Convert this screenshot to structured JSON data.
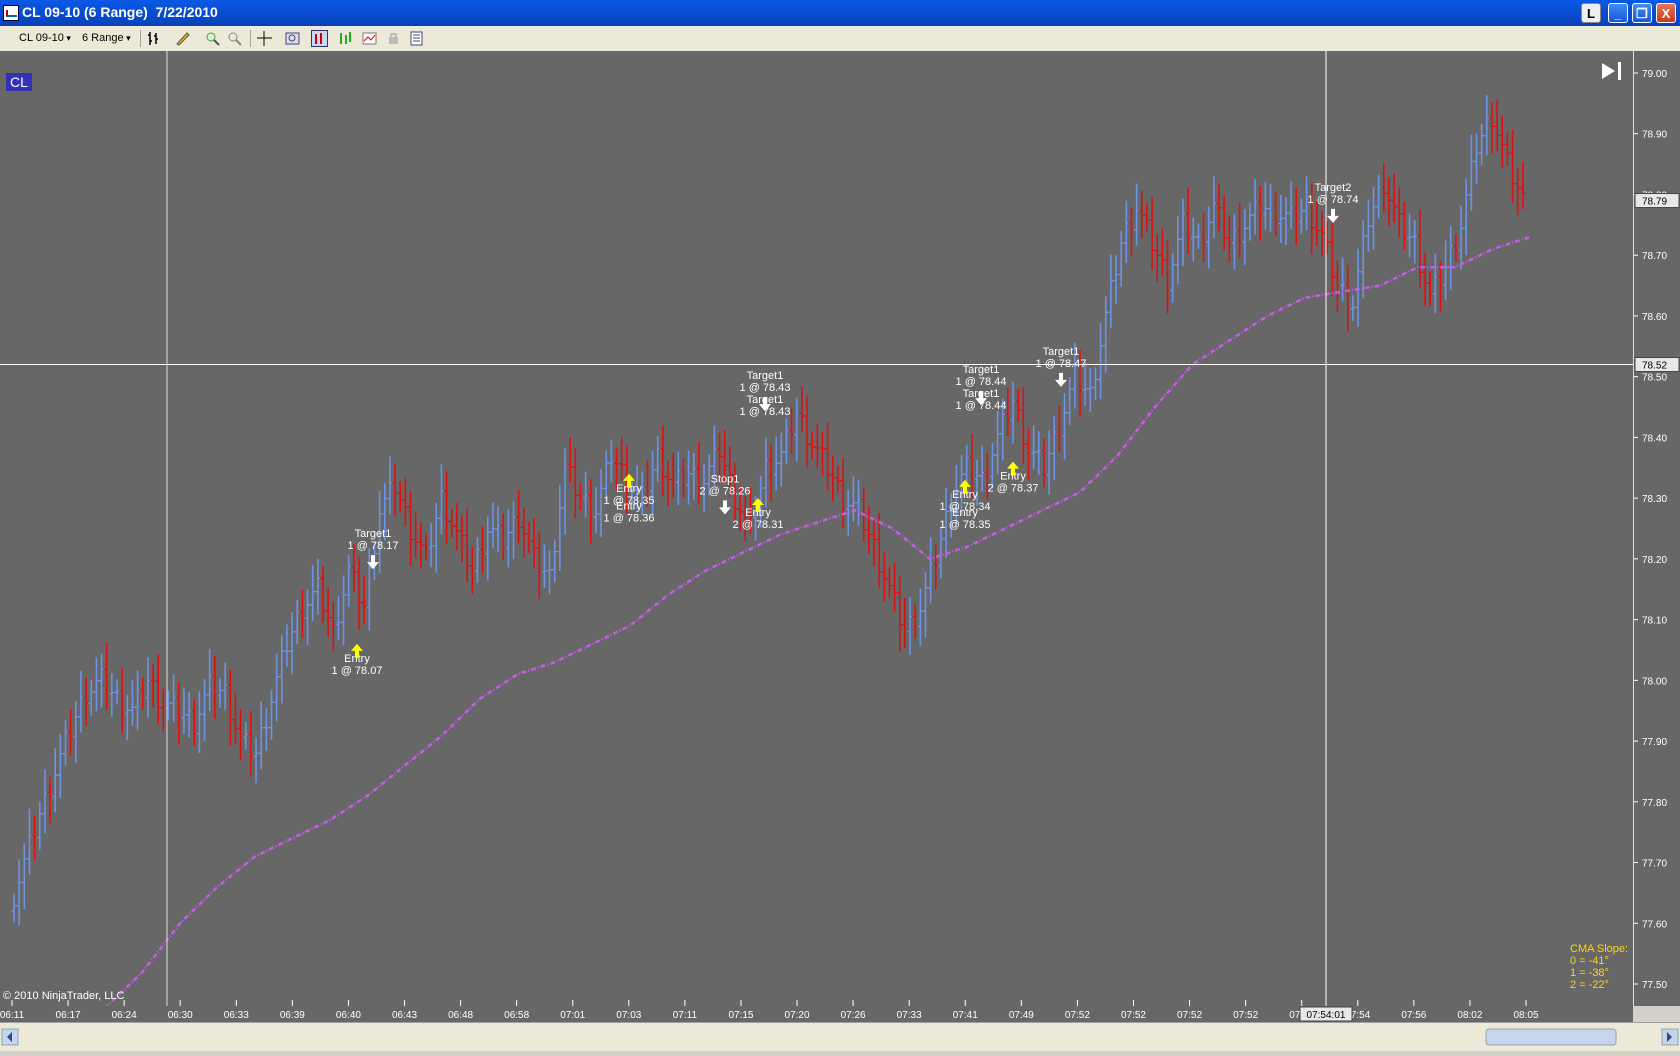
{
  "window": {
    "title": "CL 09-10 (6 Range)  7/22/2010",
    "buttons": [
      "L",
      "_",
      "❐",
      "X"
    ]
  },
  "toolbar": {
    "instrument": "CL 09-10",
    "period": "6 Range"
  },
  "chart": {
    "instrument_badge": "CL",
    "copyright": "© 2010 NinjaTrader, LLC",
    "crosshair_price": "78.52",
    "crosshair_time": "07:54:01",
    "last_price": "78.79",
    "indicator": {
      "title": "CMA Slope:",
      "lines": [
        "0 = -41°",
        "1 = -38°",
        "2 = -22°"
      ]
    },
    "colors": {
      "background": "#676767",
      "up_bar": "#6b93e6",
      "down_bar": "#e01010",
      "cma": "#c45ce6",
      "entry_arrow": "#ffff00",
      "exit_arrow": "#ffffff"
    }
  },
  "chart_data": {
    "type": "bar",
    "subtype": "ohlc-range-bars",
    "ylim": [
      77.5,
      79.0
    ],
    "y_ticks": [
      "79.00",
      "78.90",
      "78.80",
      "78.70",
      "78.60",
      "78.50",
      "78.40",
      "78.30",
      "78.20",
      "78.10",
      "78.00",
      "77.90",
      "77.80",
      "77.70",
      "77.60",
      "77.50"
    ],
    "x_ticks": [
      "06:11",
      "06:17",
      "06:24",
      "06:30",
      "06:33",
      "06:39",
      "06:40",
      "06:43",
      "06:48",
      "06:58",
      "07:01",
      "07:03",
      "07:11",
      "07:15",
      "07:20",
      "07:26",
      "07:33",
      "07:41",
      "07:49",
      "07:52",
      "07:52",
      "07:52",
      "07:52",
      "07:52",
      "07:54",
      "07:56",
      "08:02",
      "08:05"
    ],
    "price_path": [
      77.62,
      77.7,
      77.78,
      77.85,
      77.92,
      77.98,
      78.0,
      77.97,
      77.95,
      78.0,
      77.96,
      77.95,
      77.93,
      77.99,
      77.98,
      77.9,
      77.88,
      77.97,
      78.06,
      78.12,
      78.15,
      78.08,
      78.18,
      78.12,
      78.28,
      78.32,
      78.25,
      78.2,
      78.3,
      78.24,
      78.18,
      78.25,
      78.23,
      78.27,
      78.2,
      78.17,
      78.35,
      78.3,
      78.28,
      78.37,
      78.33,
      78.3,
      78.37,
      78.32,
      78.34,
      78.33,
      78.38,
      78.3,
      78.25,
      78.35,
      78.37,
      78.44,
      78.39,
      78.35,
      78.3,
      78.28,
      78.22,
      78.15,
      78.08,
      78.12,
      78.2,
      78.3,
      78.35,
      78.33,
      78.4,
      78.46,
      78.38,
      78.35,
      78.42,
      78.5,
      78.47,
      78.6,
      78.72,
      78.78,
      78.72,
      78.66,
      78.75,
      78.72,
      78.78,
      78.72,
      78.75,
      78.78,
      78.77,
      78.76,
      78.78,
      78.73,
      78.65,
      78.62,
      78.76,
      78.82,
      78.75,
      78.72,
      78.63,
      78.68,
      78.75,
      78.88,
      78.93,
      78.85,
      78.79
    ],
    "cma": [
      77.46,
      77.52,
      77.6,
      77.66,
      77.71,
      77.74,
      77.77,
      77.81,
      77.86,
      77.91,
      77.97,
      78.01,
      78.03,
      78.06,
      78.09,
      78.14,
      78.18,
      78.21,
      78.24,
      78.26,
      78.28,
      78.25,
      78.2,
      78.22,
      78.25,
      78.28,
      78.31,
      78.37,
      78.45,
      78.52,
      78.56,
      78.6,
      78.63,
      78.64,
      78.65,
      78.68,
      78.68,
      78.71,
      78.73
    ],
    "annotations": [
      {
        "text": "Target1",
        "y": 78.17
      },
      {
        "text": "1 @ 78.17",
        "y": 78.17
      },
      {
        "text": "Entry",
        "y": 78.07
      },
      {
        "text": "1 @ 78.07",
        "y": 78.07
      },
      {
        "text": "Entry",
        "y": 78.35
      },
      {
        "text": "1 @ 78.35",
        "y": 78.35
      },
      {
        "text": "Entry",
        "y": 78.36
      },
      {
        "text": "1 @ 78.36",
        "y": 78.36
      },
      {
        "text": "Stop1",
        "y": 78.26
      },
      {
        "text": "2 @ 78.26",
        "y": 78.26
      },
      {
        "text": "Entry",
        "y": 78.31
      },
      {
        "text": "2 @ 78.31",
        "y": 78.31
      },
      {
        "text": "Target1",
        "y": 78.43
      },
      {
        "text": "1 @ 78.43",
        "y": 78.43
      },
      {
        "text": "Target1",
        "y": 78.43
      },
      {
        "text": "1 @ 78.43",
        "y": 78.43
      },
      {
        "text": "Target1",
        "y": 78.44
      },
      {
        "text": "1 @ 78.44",
        "y": 78.44
      },
      {
        "text": "Target1",
        "y": 78.44
      },
      {
        "text": "1 @ 78.44",
        "y": 78.44
      },
      {
        "text": "Entry",
        "y": 78.34
      },
      {
        "text": "1 @ 78.34",
        "y": 78.34
      },
      {
        "text": "Entry",
        "y": 78.35
      },
      {
        "text": "1 @ 78.35",
        "y": 78.35
      },
      {
        "text": "Entry",
        "y": 78.37
      },
      {
        "text": "2 @ 78.37",
        "y": 78.37
      },
      {
        "text": "Target1",
        "y": 78.47
      },
      {
        "text": "1 @ 78.47",
        "y": 78.47
      },
      {
        "text": "Target2",
        "y": 78.74
      },
      {
        "text": "1 @ 78.74",
        "y": 78.74
      }
    ]
  }
}
